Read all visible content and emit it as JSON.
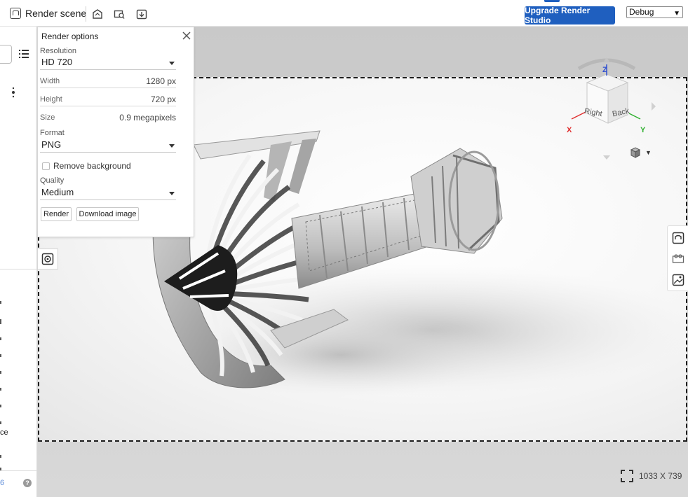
{
  "toolbar": {
    "render_scene_label": "Render scene",
    "upgrade_label": "Upgrade Render Studio",
    "debug_select": "Debug",
    "icons": [
      "appearance-icon",
      "scene-icon",
      "export-icon"
    ],
    "accent_color": "#1f5fbf"
  },
  "sidebar": {
    "truncated_text": "ce",
    "version_fragment": "6",
    "help_label": "?"
  },
  "render_options": {
    "title": "Render options",
    "resolution_label": "Resolution",
    "resolution_value": "HD 720",
    "width_label": "Width",
    "width_value": "1280 px",
    "height_label": "Height",
    "height_value": "720 px",
    "size_label": "Size",
    "size_value": "0.9 megapixels",
    "format_label": "Format",
    "format_value": "PNG",
    "remove_background_label": "Remove background",
    "remove_background_checked": false,
    "quality_label": "Quality",
    "quality_value": "Medium",
    "render_button": "Render",
    "download_button": "Download image"
  },
  "viewport": {
    "resolution_readout": "1033 X 739",
    "navcube": {
      "face_right": "Right",
      "face_back": "Back",
      "axis_z": "Z",
      "axis_x": "X",
      "axis_y": "Y",
      "colors": {
        "x": "#e03030",
        "y": "#30b030",
        "z": "#3050d0"
      }
    }
  }
}
